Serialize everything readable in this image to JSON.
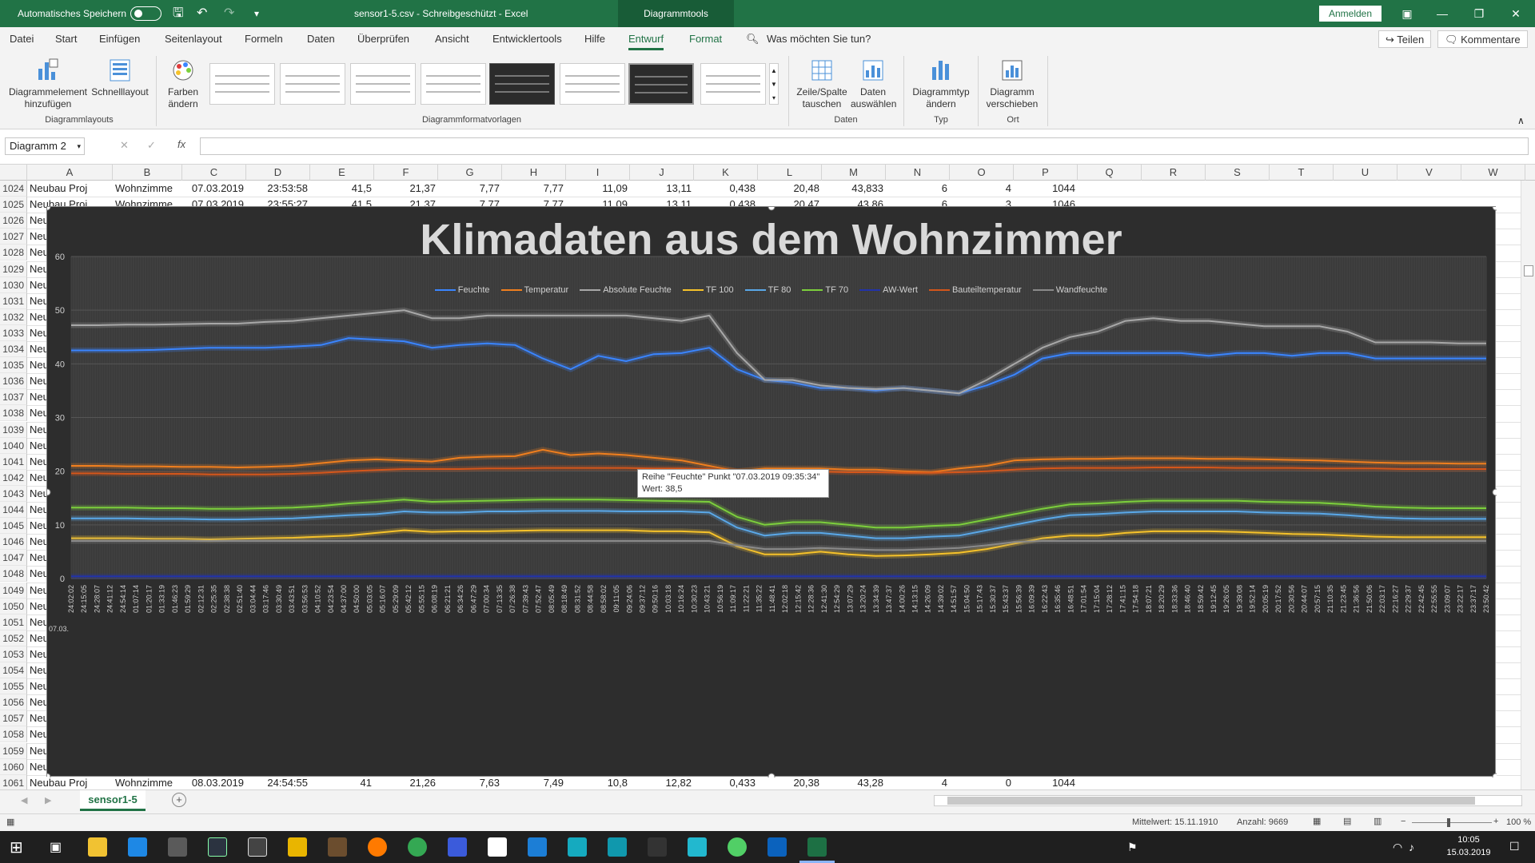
{
  "titlebar": {
    "autosave_label": "Automatisches Speichern",
    "title": "sensor1-5.csv  -  Schreibgeschützt  -  Excel",
    "contextual_tab": "Diagrammtools",
    "signin_label": "Anmelden",
    "accent": "#217346"
  },
  "menu": {
    "tabs": [
      "Datei",
      "Start",
      "Einfügen",
      "Seitenlayout",
      "Formeln",
      "Daten",
      "Überprüfen",
      "Ansicht",
      "Entwicklertools",
      "Hilfe",
      "Entwurf",
      "Format"
    ],
    "active": "Entwurf",
    "search": "Was möchten Sie tun?",
    "share": "Teilen",
    "comments": "Kommentare"
  },
  "ribbon": {
    "add_element_1": "Diagrammelement",
    "add_element_2": "hinzufügen",
    "quick_layout": "Schnelllayout",
    "colors_1": "Farben",
    "colors_2": "ändern",
    "group_layouts": "Diagrammlayouts",
    "group_styles": "Diagrammformatvorlagen",
    "switch_1": "Zeile/Spalte",
    "switch_2": "tauschen",
    "select_1": "Daten",
    "select_2": "auswählen",
    "group_data": "Daten",
    "type_1": "Diagrammtyp",
    "type_2": "ändern",
    "group_type": "Typ",
    "move_1": "Diagramm",
    "move_2": "verschieben",
    "group_location": "Ort"
  },
  "formula": {
    "namebox": "Diagramm 2",
    "fx": "fx"
  },
  "sheet": {
    "columns": [
      "A",
      "B",
      "C",
      "D",
      "E",
      "F",
      "G",
      "H",
      "I",
      "J",
      "K",
      "L",
      "M",
      "N",
      "O",
      "P",
      "Q",
      "R",
      "S",
      "T",
      "U",
      "V",
      "W"
    ],
    "row_numbers": [
      "1024",
      "1025",
      "1026",
      "1027",
      "1028",
      "1029",
      "1030",
      "1031",
      "1032",
      "1033",
      "1034",
      "1035",
      "1036",
      "1037",
      "1038",
      "1039",
      "1040",
      "1041",
      "1042",
      "1043",
      "1044",
      "1045",
      "1046",
      "1047",
      "1048",
      "1049",
      "1050",
      "1051",
      "1052",
      "1053",
      "1054",
      "1055",
      "1056",
      "1057",
      "1058",
      "1059",
      "1060",
      "1061"
    ],
    "row_1024": [
      "Neubau Proj",
      "Wohnzimme",
      "07.03.2019",
      "23:53:58",
      "41,5",
      "21,37",
      "7,77",
      "7,77",
      "11,09",
      "13,11",
      "0,438",
      "20,48",
      "43,833",
      "6",
      "4",
      "1044"
    ],
    "row_1025": [
      "Neubau Proj",
      "Wohnzimme",
      "07.03.2019",
      "23:55:27",
      "41,5",
      "21,37",
      "7,77",
      "7,77",
      "11,09",
      "13,11",
      "0,438",
      "20,47",
      "43,86",
      "6",
      "3",
      "1046"
    ],
    "row_1061": [
      "Neubau Proj",
      "Wohnzimme",
      "08.03.2019",
      "24:54:55",
      "41",
      "21,26",
      "7,63",
      "7,49",
      "10,8",
      "12,82",
      "0,433",
      "20,38",
      "43,28",
      "4",
      "0",
      "1044"
    ],
    "col_a_truncated": "Neu"
  },
  "chart_data": {
    "type": "line",
    "title": "Klimadaten aus dem Wohnzimmer",
    "ylim": [
      0,
      60
    ],
    "yticks": [
      0,
      10,
      20,
      30,
      40,
      50,
      60
    ],
    "grid": true,
    "legend_position": "top",
    "background": "#2d2d2d",
    "x_first_label": "07.03.",
    "x_time_labels": [
      "24:02:02",
      "24:15:05",
      "24:28:07",
      "24:41:12",
      "24:54:14",
      "01:07:14",
      "01:20:17",
      "01:33:19",
      "01:46:23",
      "01:59:29",
      "02:12:31",
      "02:25:35",
      "02:38:38",
      "02:51:40",
      "03:04:44",
      "03:17:46",
      "03:30:49",
      "03:43:51",
      "03:56:53",
      "04:10:52",
      "04:23:54",
      "04:37:00",
      "04:50:00",
      "05:03:05",
      "05:16:07",
      "05:29:09",
      "05:42:12",
      "05:55:15",
      "06:08:19",
      "06:21:21",
      "06:34:26",
      "06:47:29",
      "07:00:34",
      "07:13:35",
      "07:26:38",
      "07:39:43",
      "07:52:47",
      "08:05:49",
      "08:18:49",
      "08:31:52",
      "08:44:58",
      "08:58:02",
      "09:11:05",
      "09:24:06",
      "09:37:12",
      "09:50:16",
      "10:03:18",
      "10:16:24",
      "10:30:23",
      "10:43:21",
      "10:56:19",
      "11:09:17",
      "11:22:21",
      "11:35:22",
      "11:48:41",
      "12:02:18",
      "12:15:42",
      "12:28:36",
      "12:41:30",
      "12:54:29",
      "13:07:29",
      "13:20:24",
      "13:34:39",
      "13:47:37",
      "14:00:26",
      "14:13:15",
      "14:26:09",
      "14:39:02",
      "14:51:57",
      "15:04:50",
      "15:17:43",
      "15:30:37",
      "15:43:37",
      "15:56:39",
      "16:09:39",
      "16:22:43",
      "16:35:46",
      "16:48:51",
      "17:01:54",
      "17:15:04",
      "17:28:12",
      "17:41:15",
      "17:54:18",
      "18:07:21",
      "18:20:29",
      "18:33:36",
      "18:46:40",
      "18:59:42",
      "19:12:45",
      "19:26:05",
      "19:39:08",
      "19:52:14",
      "20:05:19",
      "20:17:52",
      "20:30:56",
      "20:44:07",
      "20:57:15",
      "21:10:35",
      "21:23:45",
      "21:36:56",
      "21:50:06",
      "22:03:17",
      "22:16:27",
      "22:29:37",
      "22:42:45",
      "22:55:55",
      "23:09:07",
      "23:22:17",
      "23:37:17",
      "23:50:42"
    ],
    "series": [
      {
        "name": "Feuchte",
        "color": "#3a85ff",
        "values": [
          42.5,
          42.5,
          42.5,
          42.6,
          42.8,
          43,
          43,
          43,
          43.2,
          43.5,
          44.8,
          44.5,
          44.2,
          43,
          43.5,
          43.8,
          43.5,
          41,
          39,
          41.5,
          40.5,
          41.8,
          42,
          43,
          39,
          37,
          36.5,
          35.5,
          35.5,
          35,
          35.5,
          35,
          34.5,
          36,
          38,
          41,
          42,
          42,
          42,
          42,
          42,
          41.5,
          42,
          42,
          41.5,
          42,
          42,
          41,
          41,
          41,
          41,
          41
        ]
      },
      {
        "name": "Temperatur",
        "color": "#f07f1e",
        "values": [
          21,
          21,
          20.9,
          20.9,
          20.8,
          20.8,
          20.7,
          20.8,
          21,
          21.5,
          22,
          22.2,
          22,
          21.8,
          22.5,
          22.7,
          22.8,
          24,
          23,
          23.3,
          23,
          22.5,
          22,
          21,
          20,
          20.5,
          20.5,
          20.5,
          20.3,
          20.3,
          20,
          19.8,
          20.5,
          21,
          22,
          22.2,
          22.3,
          22.3,
          22.4,
          22.4,
          22.4,
          22.3,
          22.3,
          22.2,
          22.1,
          22,
          21.8,
          21.6,
          21.5,
          21.5,
          21.4,
          21.4
        ]
      },
      {
        "name": "Absolute Feuchte",
        "color": "#a8a8a8",
        "values": [
          47.2,
          47.2,
          47.3,
          47.3,
          47.4,
          47.5,
          47.5,
          47.8,
          48,
          48.5,
          49,
          49.5,
          50,
          48.5,
          48.5,
          49,
          49,
          49,
          49,
          49,
          49,
          48.5,
          48,
          49,
          42,
          37,
          37,
          36,
          35.5,
          35.3,
          35.5,
          35,
          34.5,
          37,
          40,
          43,
          45,
          46,
          48,
          48.5,
          48,
          48,
          47.5,
          47,
          47,
          47,
          46,
          44,
          44,
          44,
          43.8,
          43.8
        ]
      },
      {
        "name": "TF 100",
        "color": "#f6c22a",
        "values": [
          7.5,
          7.5,
          7.5,
          7.4,
          7.4,
          7.3,
          7.4,
          7.5,
          7.6,
          7.8,
          8,
          8.5,
          9,
          8.7,
          8.8,
          8.8,
          8.9,
          9,
          9,
          9,
          9,
          8.8,
          8.8,
          8.6,
          6,
          4.5,
          4.5,
          5,
          4.5,
          4.2,
          4.3,
          4.5,
          4.8,
          5.5,
          6.5,
          7.5,
          8,
          8,
          8.5,
          8.8,
          8.8,
          8.8,
          8.7,
          8.5,
          8.3,
          8.2,
          8,
          7.8,
          7.7,
          7.7,
          7.7,
          7.7
        ]
      },
      {
        "name": "TF 80",
        "color": "#5aa8e8",
        "values": [
          11.2,
          11.2,
          11.2,
          11.1,
          11.1,
          11,
          11,
          11.1,
          11.2,
          11.5,
          11.8,
          12,
          12.5,
          12.3,
          12.3,
          12.5,
          12.5,
          12.6,
          12.6,
          12.6,
          12.5,
          12.5,
          12.5,
          12.3,
          9.5,
          8,
          8.5,
          8.5,
          8,
          7.5,
          7.5,
          7.8,
          8,
          9,
          10,
          11,
          11.8,
          12,
          12.3,
          12.5,
          12.5,
          12.5,
          12.5,
          12.3,
          12.2,
          12.1,
          11.8,
          11.4,
          11.2,
          11.1,
          11.1,
          11.1
        ]
      },
      {
        "name": "TF 70",
        "color": "#7ccf3c",
        "values": [
          13.2,
          13.2,
          13.2,
          13.1,
          13.1,
          13,
          13,
          13.1,
          13.2,
          13.5,
          14,
          14.3,
          14.7,
          14.3,
          14.4,
          14.5,
          14.6,
          14.7,
          14.7,
          14.7,
          14.6,
          14.5,
          14.4,
          14.3,
          11.5,
          10,
          10.5,
          10.5,
          10,
          9.5,
          9.5,
          9.8,
          10,
          11,
          12,
          13,
          13.8,
          14,
          14.3,
          14.5,
          14.5,
          14.5,
          14.5,
          14.3,
          14.2,
          14.1,
          13.8,
          13.4,
          13.2,
          13.1,
          13.1,
          13.1
        ]
      },
      {
        "name": "AW-Wert",
        "color": "#2233aa",
        "values": [
          0.4,
          0.4,
          0.4,
          0.4,
          0.4,
          0.4,
          0.4,
          0.4,
          0.4,
          0.4,
          0.4,
          0.4,
          0.4,
          0.4,
          0.4,
          0.4,
          0.4,
          0.4,
          0.4,
          0.4,
          0.4,
          0.4,
          0.4,
          0.4,
          0.4,
          0.4,
          0.4,
          0.4,
          0.4,
          0.4,
          0.4,
          0.4,
          0.4,
          0.4,
          0.4,
          0.4,
          0.4,
          0.4,
          0.4,
          0.4,
          0.4,
          0.4,
          0.4,
          0.4,
          0.4,
          0.4,
          0.4,
          0.4,
          0.4,
          0.4,
          0.4,
          0.4
        ]
      },
      {
        "name": "Bauteiltemperatur",
        "color": "#d4561b",
        "values": [
          19.6,
          19.6,
          19.5,
          19.5,
          19.5,
          19.4,
          19.4,
          19.4,
          19.5,
          19.7,
          20,
          20.2,
          20.4,
          20.4,
          20.4,
          20.5,
          20.5,
          20.6,
          20.6,
          20.6,
          20.6,
          20.5,
          20.5,
          20.4,
          20,
          19.8,
          19.9,
          19.9,
          19.8,
          19.8,
          19.7,
          19.7,
          19.8,
          20,
          20.3,
          20.5,
          20.6,
          20.6,
          20.6,
          20.7,
          20.7,
          20.7,
          20.6,
          20.6,
          20.6,
          20.5,
          20.5,
          20.5,
          20.4,
          20.4,
          20.4,
          20.4
        ]
      },
      {
        "name": "Wandfeuchte",
        "color": "#8a8a8a",
        "values": [
          7,
          7,
          7,
          7,
          7,
          7,
          7,
          7,
          7,
          7,
          7,
          7,
          7,
          7,
          7,
          7,
          7,
          7,
          7,
          7,
          7,
          7,
          7,
          7,
          6.2,
          5.5,
          5.5,
          5.7,
          5.5,
          5.3,
          5.3,
          5.5,
          5.7,
          6.2,
          6.8,
          7,
          7,
          7,
          7,
          7,
          7,
          7,
          7,
          7,
          7,
          7,
          7,
          7,
          7,
          7,
          7,
          7
        ]
      }
    ],
    "tooltip_line1": "Reihe \"Feuchte\" Punkt \"07.03.2019 09:35:34\"",
    "tooltip_line2": "Wert: 38,5"
  },
  "sheet_tab": "sensor1-5",
  "status": {
    "average": "Mittelwert: 15.11.1910",
    "count": "Anzahl: 9669",
    "zoom": "100 %"
  },
  "taskbar": {
    "time": "10:05",
    "date": "15.03.2019"
  }
}
